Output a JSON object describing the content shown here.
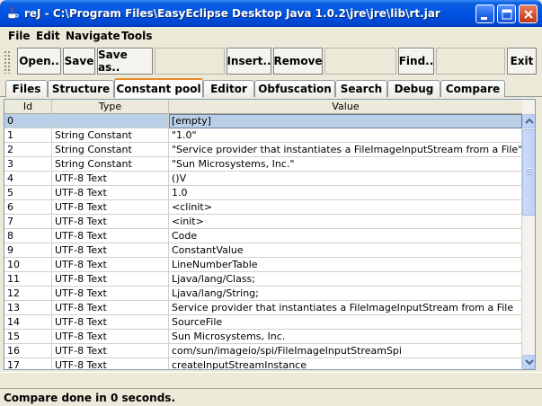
{
  "window": {
    "title": "reJ - C:\\Program Files\\EasyEclipse Desktop Java 1.0.2\\jre\\jre\\lib\\rt.jar"
  },
  "menu": [
    "File",
    "Edit",
    "Navigate",
    "Tools"
  ],
  "toolbar": {
    "open_label": "Open..",
    "save_label": "Save",
    "save_as_label": "Save as..",
    "insert_label": "Insert..",
    "remove_label": "Remove",
    "find_label": "Find..",
    "exit_label": "Exit"
  },
  "tabs": [
    "Files",
    "Structure",
    "Constant pool",
    "Editor",
    "Obfuscation",
    "Search",
    "Debug",
    "Compare"
  ],
  "active_tab": "Constant pool",
  "table": {
    "columns": [
      "Id",
      "Type",
      "Value"
    ],
    "rows": [
      [
        "0",
        "",
        "[empty]"
      ],
      [
        "1",
        "String Constant",
        "\"1.0\""
      ],
      [
        "2",
        "String Constant",
        "\"Service provider that instantiates a FileImageInputStream from a File\""
      ],
      [
        "3",
        "String Constant",
        "\"Sun Microsystems, Inc.\""
      ],
      [
        "4",
        "UTF-8 Text",
        "()V"
      ],
      [
        "5",
        "UTF-8 Text",
        "1.0"
      ],
      [
        "6",
        "UTF-8 Text",
        "<clinit>"
      ],
      [
        "7",
        "UTF-8 Text",
        "<init>"
      ],
      [
        "8",
        "UTF-8 Text",
        "Code"
      ],
      [
        "9",
        "UTF-8 Text",
        "ConstantValue"
      ],
      [
        "10",
        "UTF-8 Text",
        "LineNumberTable"
      ],
      [
        "11",
        "UTF-8 Text",
        "Ljava/lang/Class;"
      ],
      [
        "12",
        "UTF-8 Text",
        "Ljava/lang/String;"
      ],
      [
        "13",
        "UTF-8 Text",
        "Service provider that instantiates a FileImageInputStream from a File"
      ],
      [
        "14",
        "UTF-8 Text",
        "SourceFile"
      ],
      [
        "15",
        "UTF-8 Text",
        "Sun Microsystems, Inc."
      ],
      [
        "16",
        "UTF-8 Text",
        "com/sun/imageio/spi/FileImageInputStreamSpi"
      ],
      [
        "17",
        "UTF-8 Text",
        "createInputStreamInstance"
      ]
    ]
  },
  "status": "Compare done in 0 seconds.",
  "colors": {
    "titlebar": "#0054e3",
    "selection": "#b8cfe5",
    "active_tab_accent": "#e68b2c"
  }
}
